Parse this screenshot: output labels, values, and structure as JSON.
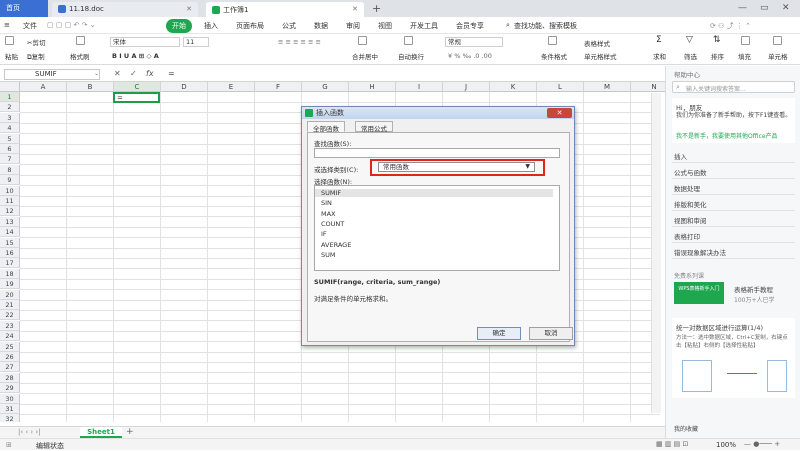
{
  "tabs": {
    "home": "首页",
    "doc": "11.18.doc",
    "workbook": "工作簿1"
  },
  "menu": {
    "file": "文件",
    "start": "开始",
    "insert": "插入",
    "page_layout": "页面布局",
    "formula": "公式",
    "data": "数据",
    "review": "审阅",
    "view": "视图",
    "dev_tools": "开发工具",
    "member": "会员专享",
    "search_hint": "查找功能、搜索模板"
  },
  "ribbon": {
    "paste": "粘贴",
    "cut": "剪切",
    "copy": "复制",
    "format_painter": "格式刷",
    "font_name": "宋体",
    "font_size": "11",
    "merge_center": "合并居中",
    "wrap_text": "自动换行",
    "number_format": "常规",
    "cond_format": "条件格式",
    "table_style": "表格样式",
    "cell_style": "单元格样式",
    "sum": "求和",
    "filter": "筛选",
    "sort": "排序",
    "fill": "填充",
    "cell": "单元格"
  },
  "formula_bar": {
    "name_box": "SUMIF",
    "content": "="
  },
  "grid": {
    "columns": [
      "A",
      "B",
      "C",
      "D",
      "E",
      "F",
      "G",
      "H",
      "I",
      "J",
      "K",
      "L",
      "M",
      "N"
    ],
    "rows": [
      "1",
      "2",
      "3",
      "4",
      "5",
      "6",
      "7",
      "8",
      "9",
      "10",
      "11",
      "12",
      "13",
      "14",
      "15",
      "16",
      "17",
      "18",
      "19",
      "20",
      "21",
      "22",
      "23",
      "24",
      "25",
      "26",
      "27",
      "28",
      "29",
      "30",
      "31",
      "32"
    ],
    "active_cell_value": "="
  },
  "sheet": {
    "name": "Sheet1",
    "status": "编辑状态",
    "zoom": "100%"
  },
  "dialog": {
    "title": "插入函数",
    "tab_all": "全部函数",
    "tab_common": "常用公式",
    "search_label": "查找函数(S):",
    "category_label": "或选择类别(C):",
    "category_value": "常用函数",
    "select_label": "选择函数(N):",
    "functions": [
      "SUMIF",
      "SIN",
      "MAX",
      "COUNT",
      "IF",
      "AVERAGE",
      "SUM"
    ],
    "signature": "SUMIF(range, criteria, sum_range)",
    "description": "对满足条件的单元格求和。",
    "ok": "确定",
    "cancel": "取消"
  },
  "side_panel": {
    "header": "帮助中心",
    "search_placeholder": "输入关键词搜索答案...",
    "greeting": "Hi，朋友",
    "intro": "我们为你准备了新手帮助，按下F1键查看。",
    "link": "我不是新手，我要使用其他Office产品",
    "sections": [
      "插入",
      "公式与函数",
      "数据处理",
      "排版和美化",
      "视图和审阅",
      "表格打印",
      "错误现象解决办法"
    ],
    "course_label": "免费系列课",
    "course_title": "表格新手教程",
    "course_count": "100万+人已学",
    "course_thumb": "WPS表格新手入门",
    "tip_title": "统一对数据区域进行运算(1/4)",
    "tip_text": "方法一：选中数据区域，Ctrl+C复制，右键点击【粘贴】右侧的【选择性粘贴】",
    "favorites": "我的收藏"
  }
}
